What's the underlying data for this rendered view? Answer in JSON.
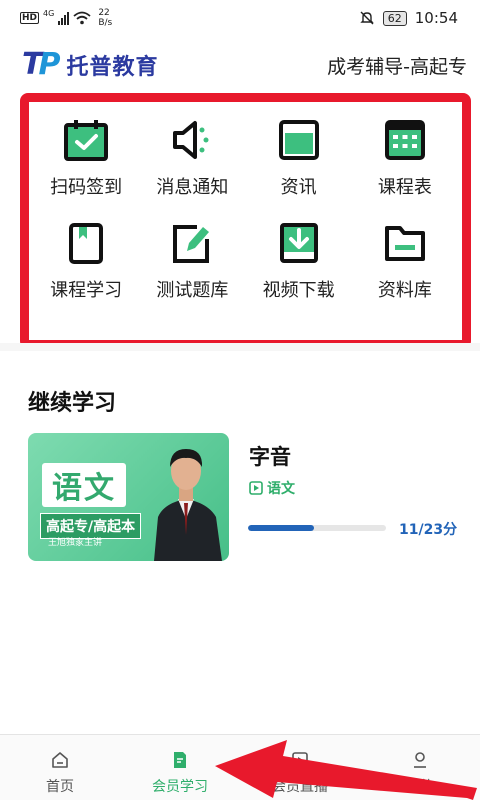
{
  "status_bar": {
    "hd": "HD",
    "network": "4G",
    "speed_value": "22",
    "speed_unit": "B/s",
    "battery": "62",
    "time": "10:54"
  },
  "header": {
    "logo_t": "T",
    "logo_p": "P",
    "brand_name": "托普教育",
    "course_title": "成考辅导-高起专"
  },
  "grid": {
    "items": [
      {
        "label": "扫码签到",
        "icon": "calendar-check-icon"
      },
      {
        "label": "消息通知",
        "icon": "speaker-icon"
      },
      {
        "label": "资讯",
        "icon": "window-icon"
      },
      {
        "label": "课程表",
        "icon": "timetable-icon"
      },
      {
        "label": "课程学习",
        "icon": "book-icon"
      },
      {
        "label": "测试题库",
        "icon": "edit-icon"
      },
      {
        "label": "视频下载",
        "icon": "download-icon"
      },
      {
        "label": "资料库",
        "icon": "folder-icon"
      }
    ]
  },
  "continue_learning": {
    "title": "继续学习",
    "course": {
      "thumb_subject": "语文",
      "thumb_level": "高起专/高起本",
      "thumb_teacher": "王旭独家主讲",
      "name": "字音",
      "type_label": "语文",
      "progress_text": "11/23分",
      "progress_fraction": 0.478
    }
  },
  "bottom_nav": {
    "items": [
      {
        "label": "首页",
        "icon": "home-icon"
      },
      {
        "label": "会员学习",
        "icon": "member-study-icon",
        "active": true
      },
      {
        "label": "会员直播",
        "icon": "live-play-icon"
      },
      {
        "label": "我的",
        "icon": "profile-icon"
      }
    ]
  },
  "colors": {
    "accent_green": "#2fae6b",
    "highlight_red": "#e8192c",
    "progress_blue": "#2264b8",
    "brand_blue": "#2b3aa0"
  }
}
